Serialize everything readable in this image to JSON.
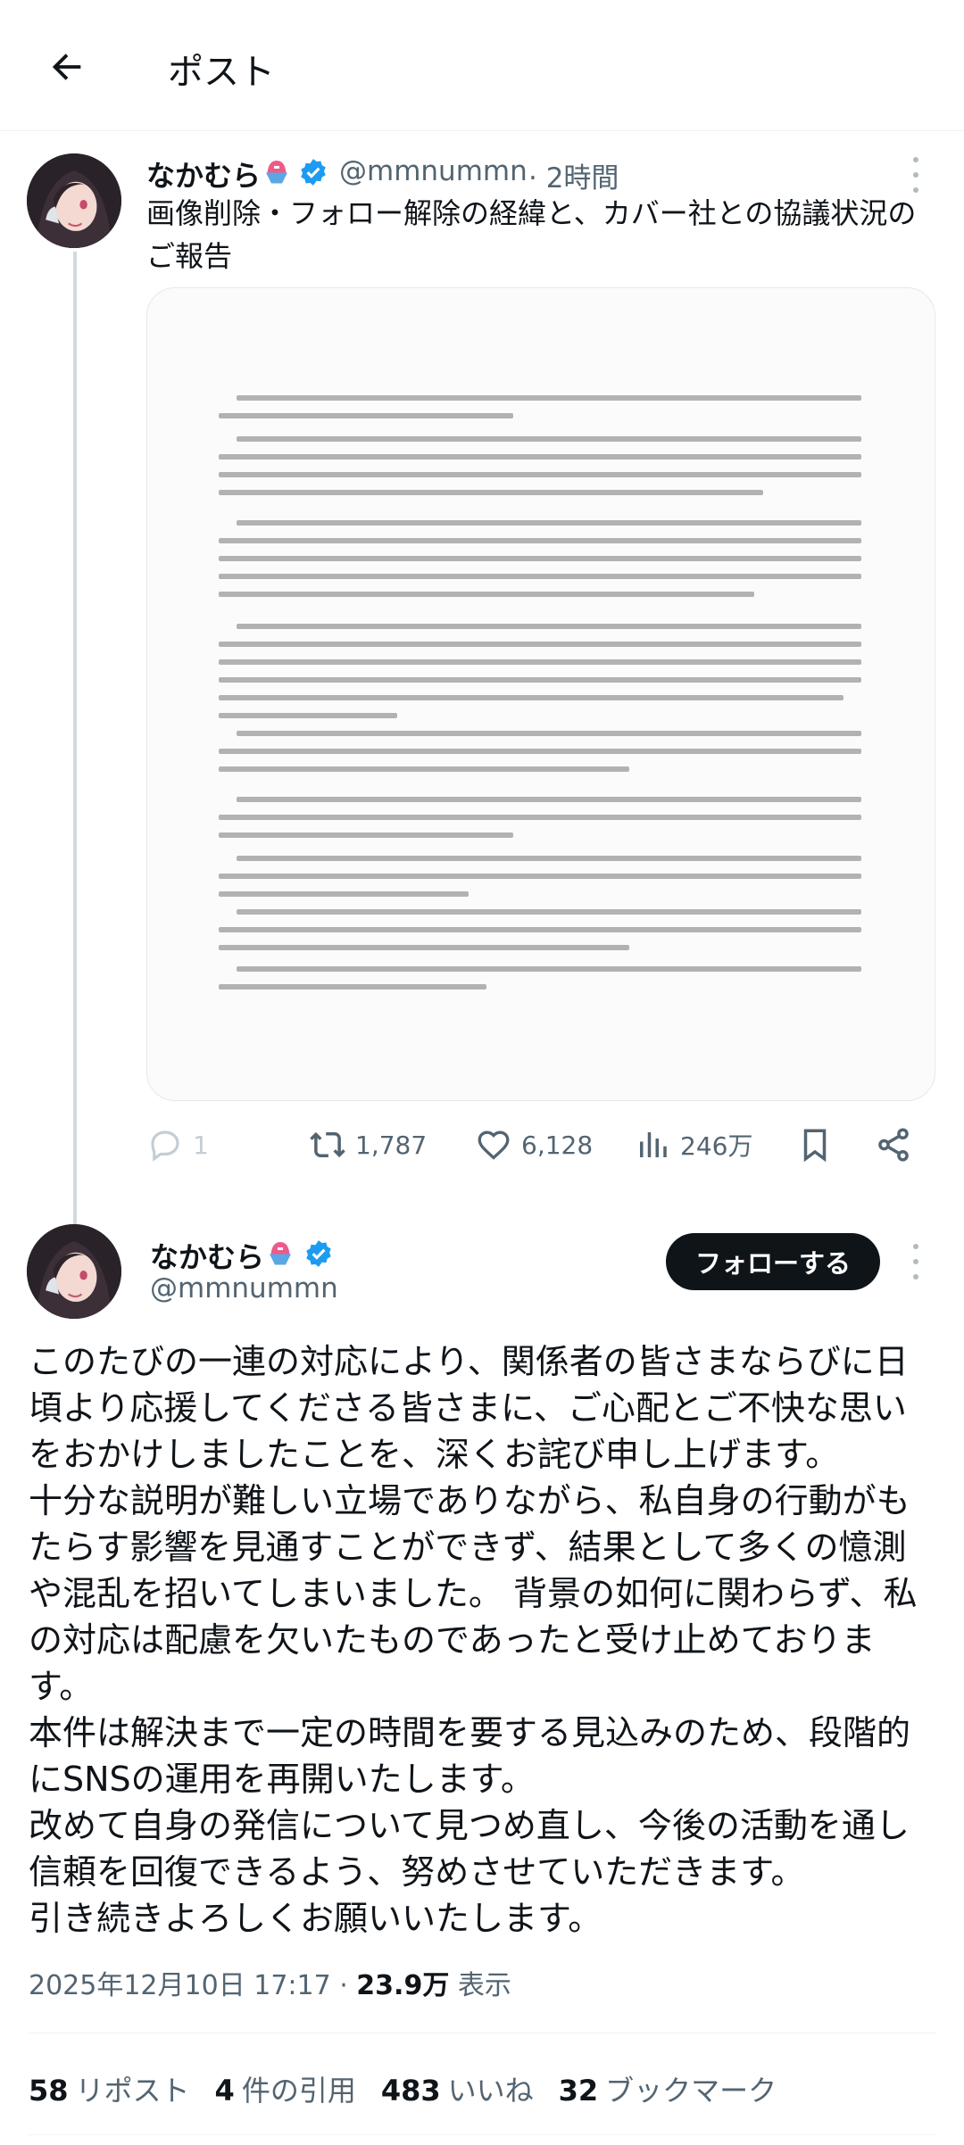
{
  "header": {
    "title": "ポスト"
  },
  "quoted": {
    "name": "なかむら",
    "handle": "@mmnummn",
    "time": "· 2時間",
    "text": "画像削除・フォロー解除の経緯と、カバー社との協議状況のご報告",
    "actions": {
      "replies": "1",
      "reposts": "1,787",
      "likes": "6,128",
      "views": "246万"
    }
  },
  "main": {
    "name": "なかむら",
    "handle": "@mmnummn",
    "follow_label": "フォローする",
    "paragraphs": [
      "このたびの一連の対応により、関係者の皆さまならびに日頃より応援してくださる皆さまに、ご心配とご不快な思いをおかけしましたことを、深くお詫び申し上げます。",
      "十分な説明が難しい立場でありながら、私自身の行動がもたらす影響を見通すことができず、結果として多くの憶測や混乱を招いてしまいました。 背景の如何に関わらず、私の対応は配慮を欠いたものであったと受け止めております。",
      "本件は解決まで一定の時間を要する見込みのため、段階的にSNSの運用を再開いたします。",
      "改めて自身の発信について見つめ直し、今後の活動を通し信頼を回復できるよう、努めさせていただきます。",
      "引き続きよろしくお願いいたします。"
    ],
    "date": "2025年12月10日 17:17 · ",
    "views_count": "23.9万",
    "views_label": " 表示",
    "stats": {
      "reposts_count": "58",
      "reposts_label": "リポスト",
      "quotes_count": "4",
      "quotes_label": "件の引用",
      "likes_count": "483",
      "likes_label": "いいね",
      "bookmarks_count": "32",
      "bookmarks_label": "ブックマーク"
    }
  },
  "colors": {
    "accent": "#1d9bf0",
    "text": "#0f1419",
    "muted": "#536471",
    "follow_bg": "#0f1419"
  }
}
